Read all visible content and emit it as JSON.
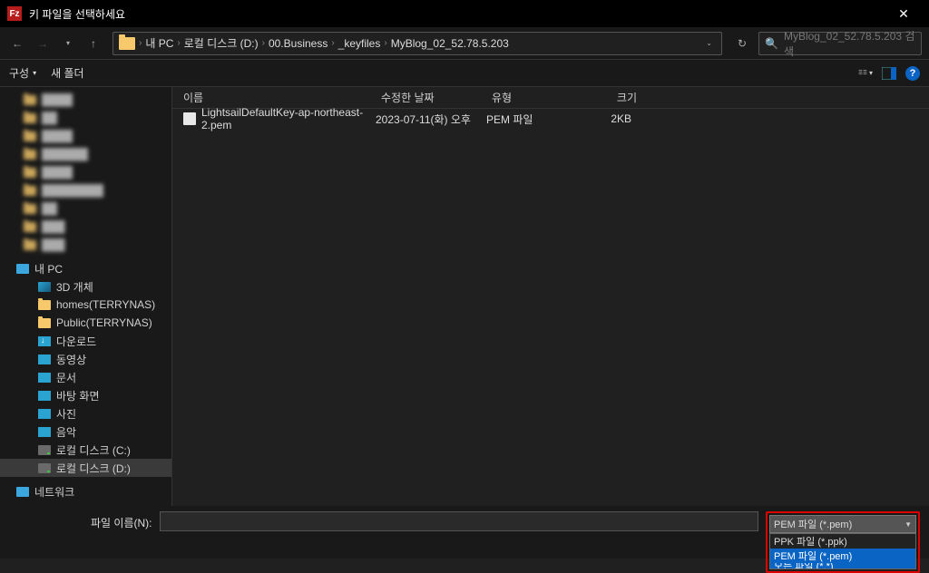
{
  "window": {
    "title": "키 파일을 선택하세요",
    "app_label": "Fz"
  },
  "nav": {
    "breadcrumb": [
      "내 PC",
      "로컬 디스크 (D:)",
      "00.Business",
      "_keyfiles",
      "MyBlog_02_52.78.5.203"
    ],
    "search_placeholder": "MyBlog_02_52.78.5.203 검색"
  },
  "toolbar": {
    "organize": "구성",
    "new_folder": "새 폴더",
    "help": "?"
  },
  "sidebar": {
    "blurred": [
      "████",
      "██",
      "████",
      "██████",
      "████",
      "████████",
      "██",
      "███",
      "███"
    ],
    "my_pc": "내 PC",
    "items": [
      {
        "icon": "3d",
        "label": "3D 개체"
      },
      {
        "icon": "nasfolder",
        "label": "homes(TERRYNAS)"
      },
      {
        "icon": "nasfolder",
        "label": "Public(TERRYNAS)"
      },
      {
        "icon": "download",
        "label": "다운로드"
      },
      {
        "icon": "video",
        "label": "동영상"
      },
      {
        "icon": "doc",
        "label": "문서"
      },
      {
        "icon": "desktop",
        "label": "바탕 화면"
      },
      {
        "icon": "pic",
        "label": "사진"
      },
      {
        "icon": "music",
        "label": "음악"
      },
      {
        "icon": "drive",
        "label": "로컬 디스크 (C:)"
      },
      {
        "icon": "drive",
        "label": "로컬 디스크 (D:)",
        "selected": true
      }
    ],
    "network": "네트워크"
  },
  "columns": {
    "name": "이름",
    "date": "수정한 날짜",
    "type": "유형",
    "size": "크기"
  },
  "files": [
    {
      "name": "LightsailDefaultKey-ap-northeast-2.pem",
      "date": "2023-07-11(화) 오후",
      "type": "PEM 파일",
      "size": "2KB"
    }
  ],
  "footer": {
    "filename_label": "파일 이름(N):",
    "filename_value": "",
    "filter_selected": "PEM 파일 (*.pem)",
    "filter_options": [
      "PPK 파일 (*.ppk)",
      "PEM 파일 (*.pem)",
      "모든 파일 (*.*)"
    ]
  }
}
